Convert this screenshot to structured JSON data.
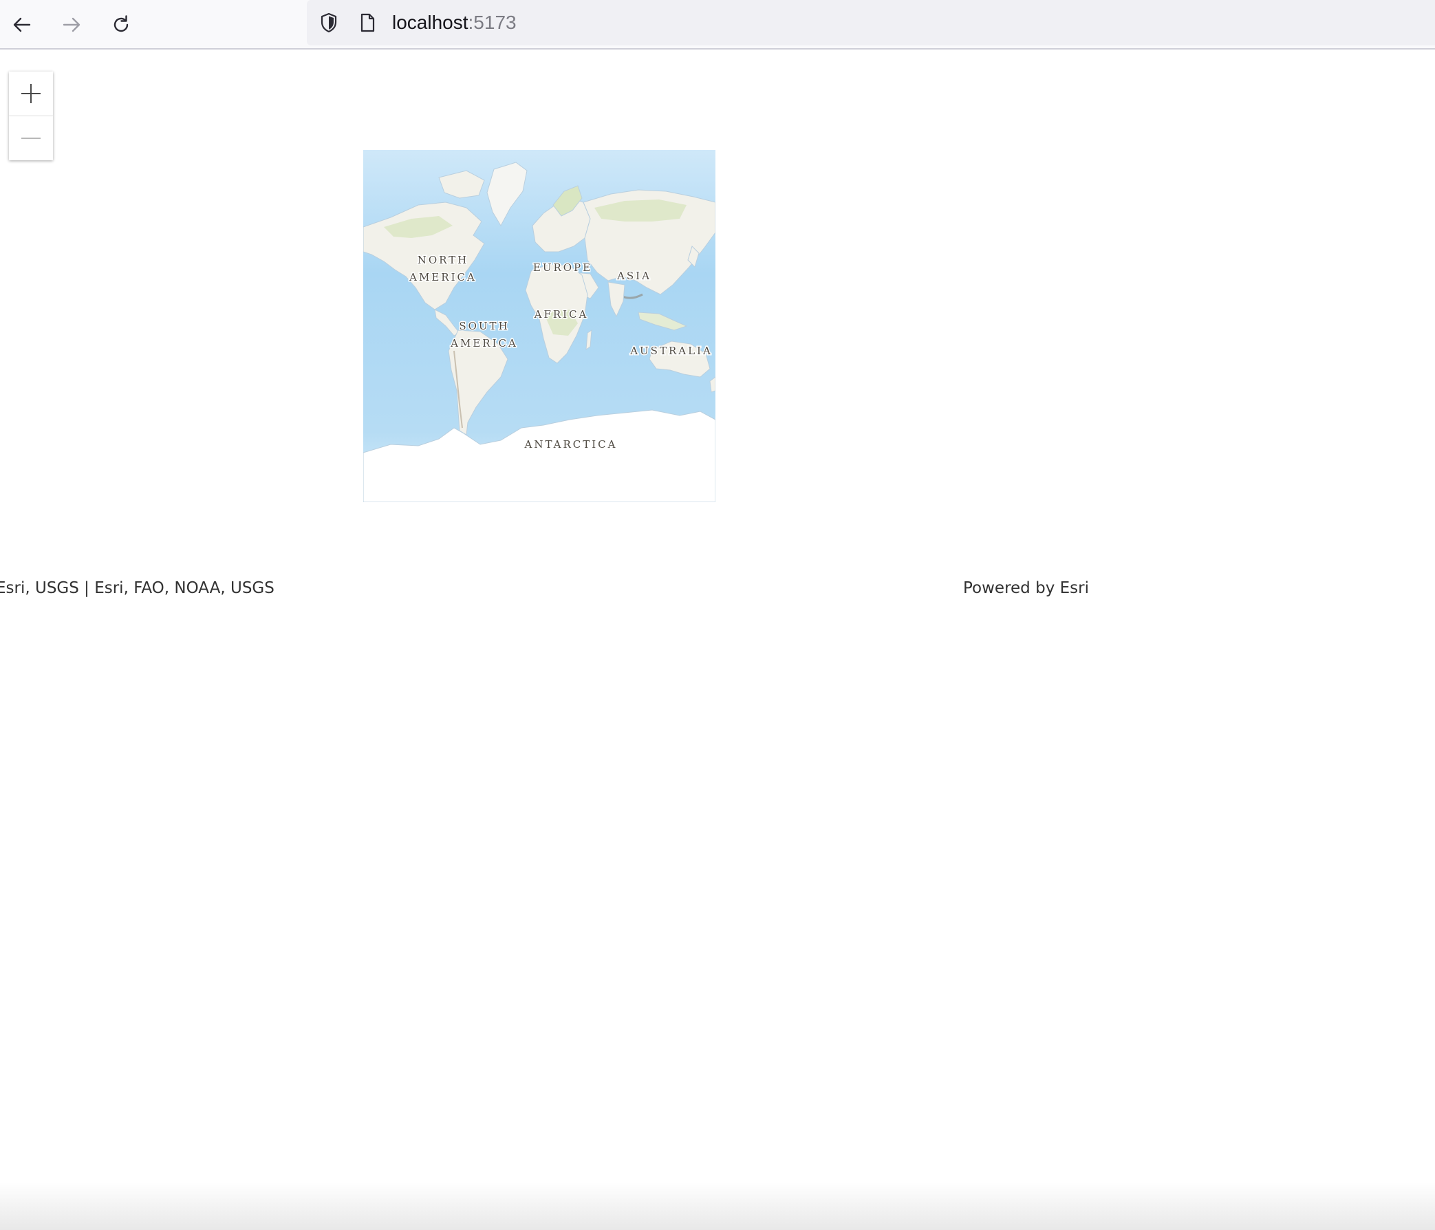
{
  "browser": {
    "url_host": "localhost",
    "url_port": ":5173",
    "icons": {
      "back": "arrow-left-icon",
      "forward": "arrow-right-icon",
      "reload": "reload-icon",
      "tracking": "shield-icon",
      "page": "page-icon"
    }
  },
  "map": {
    "zoom_in_icon": "plus-icon",
    "zoom_out_icon": "minus-icon",
    "labels": {
      "north": "NORTH",
      "america": "AMERICA",
      "south": "SOUTH",
      "south_america": "AMERICA",
      "europe": "EUROPE",
      "asia": "ASIA",
      "africa": "AFRICA",
      "australia": "AUSTRALIA",
      "antarctica": "ANTARCTICA"
    },
    "colors": {
      "ocean": "#a9d6f3",
      "ocean_light": "#d8eefb",
      "land": "#f2f1ea",
      "vegetation": "#d9e6c2"
    },
    "attribution": "Esri, USGS | Esri, FAO, NOAA, USGS",
    "powered_by": "Powered by Esri"
  }
}
